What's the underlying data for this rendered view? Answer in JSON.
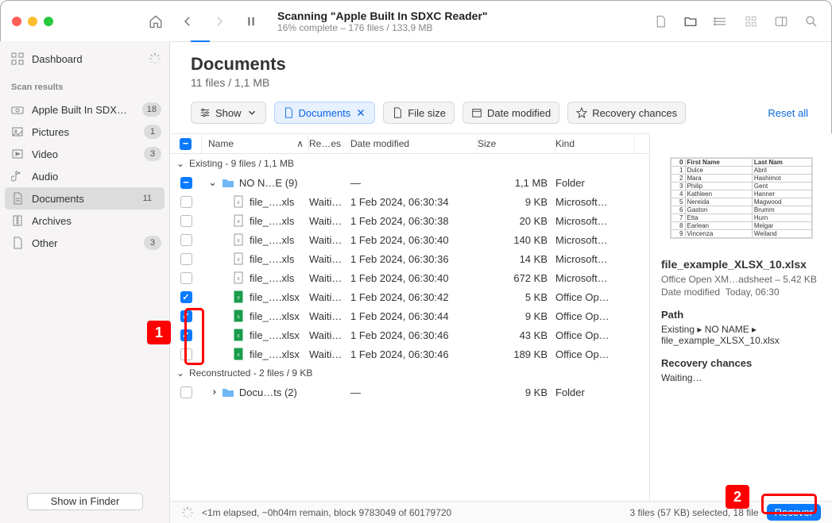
{
  "titlebar": {
    "scan_title": "Scanning \"Apple Built In SDXC Reader\"",
    "scan_sub": "16% complete – 176 files / 133,9 MB"
  },
  "sidebar": {
    "dashboard": "Dashboard",
    "heading": "Scan results",
    "items": [
      {
        "label": "Apple Built In SDXC…",
        "badge": "18"
      },
      {
        "label": "Pictures",
        "badge": "1"
      },
      {
        "label": "Video",
        "badge": "3"
      },
      {
        "label": "Audio",
        "badge": ""
      },
      {
        "label": "Documents",
        "badge": "11"
      },
      {
        "label": "Archives",
        "badge": ""
      },
      {
        "label": "Other",
        "badge": "3"
      }
    ],
    "show_finder": "Show in Finder"
  },
  "page": {
    "title": "Documents",
    "subtitle": "11 files / 1,1 MB"
  },
  "filters": {
    "show": "Show",
    "documents": "Documents",
    "file_size": "File size",
    "date_modified": "Date modified",
    "recovery": "Recovery chances",
    "reset": "Reset all"
  },
  "columns": {
    "name": "Name",
    "re": "Re…es",
    "date": "Date modified",
    "size": "Size",
    "kind": "Kind"
  },
  "groups": {
    "existing": "Existing - 9 files / 1,1 MB",
    "reconstructed": "Reconstructed - 2 files / 9 KB"
  },
  "folder_row": {
    "name": "NO N…E (9)",
    "date": "—",
    "size": "1,1 MB",
    "kind": "Folder"
  },
  "files": [
    {
      "name": "file_….xls",
      "re": "Waiti…",
      "date": "1 Feb 2024, 06:30:34",
      "size": "9 KB",
      "kind": "Microsoft…",
      "check": false,
      "icon": "xls"
    },
    {
      "name": "file_….xls",
      "re": "Waiti…",
      "date": "1 Feb 2024, 06:30:38",
      "size": "20 KB",
      "kind": "Microsoft…",
      "check": false,
      "icon": "xls"
    },
    {
      "name": "file_….xls",
      "re": "Waiti…",
      "date": "1 Feb 2024, 06:30:40",
      "size": "140 KB",
      "kind": "Microsoft…",
      "check": false,
      "icon": "xls"
    },
    {
      "name": "file_….xls",
      "re": "Waiti…",
      "date": "1 Feb 2024, 06:30:36",
      "size": "14 KB",
      "kind": "Microsoft…",
      "check": false,
      "icon": "xls"
    },
    {
      "name": "file_….xls",
      "re": "Waiti…",
      "date": "1 Feb 2024, 06:30:40",
      "size": "672 KB",
      "kind": "Microsoft…",
      "check": false,
      "icon": "xls"
    },
    {
      "name": "file_….xlsx",
      "re": "Waiti…",
      "date": "1 Feb 2024, 06:30:42",
      "size": "5 KB",
      "kind": "Office Op…",
      "check": true,
      "icon": "xlsx"
    },
    {
      "name": "file_….xlsx",
      "re": "Waiti…",
      "date": "1 Feb 2024, 06:30:44",
      "size": "9 KB",
      "kind": "Office Op…",
      "check": true,
      "icon": "xlsx"
    },
    {
      "name": "file_….xlsx",
      "re": "Waiti…",
      "date": "1 Feb 2024, 06:30:46",
      "size": "43 KB",
      "kind": "Office Op…",
      "check": true,
      "icon": "xlsx"
    },
    {
      "name": "file_….xlsx",
      "re": "Waiti…",
      "date": "1 Feb 2024, 06:30:46",
      "size": "189 KB",
      "kind": "Office Op…",
      "check": false,
      "icon": "xlsx"
    }
  ],
  "recon_folder": {
    "name": "Docu…ts (2)",
    "date": "—",
    "size": "9 KB",
    "kind": "Folder"
  },
  "preview": {
    "table": [
      [
        "0",
        "First Name",
        "Last Nam"
      ],
      [
        "1",
        "Dulce",
        "Abril"
      ],
      [
        "2",
        "Mara",
        "Hashimot"
      ],
      [
        "3",
        "Philip",
        "Gent"
      ],
      [
        "4",
        "Kathleen",
        "Hanner"
      ],
      [
        "5",
        "Nereida",
        "Magwood"
      ],
      [
        "6",
        "Gaston",
        "Brumm"
      ],
      [
        "7",
        "Etta",
        "Hurn"
      ],
      [
        "8",
        "Earlean",
        "Melgar"
      ],
      [
        "9",
        "Vincenza",
        "Weiland"
      ]
    ],
    "title": "file_example_XLSX_10.xlsx",
    "line1": "Office Open XM…adsheet – 5.42 KB",
    "line2_a": "Date modified",
    "line2_b": "Today, 06:30",
    "path_h": "Path",
    "path": "Existing ▸ NO NAME ▸ file_example_XLSX_10.xlsx",
    "rc_h": "Recovery chances",
    "rc": "Waiting…"
  },
  "footer": {
    "left": "<1m elapsed, ~0h04m remain, block 9783049 of 60179720",
    "selected": "3 files (57 KB) selected, 18 file",
    "recover": "Recover"
  },
  "annotations": {
    "a1": "1",
    "a2": "2"
  }
}
